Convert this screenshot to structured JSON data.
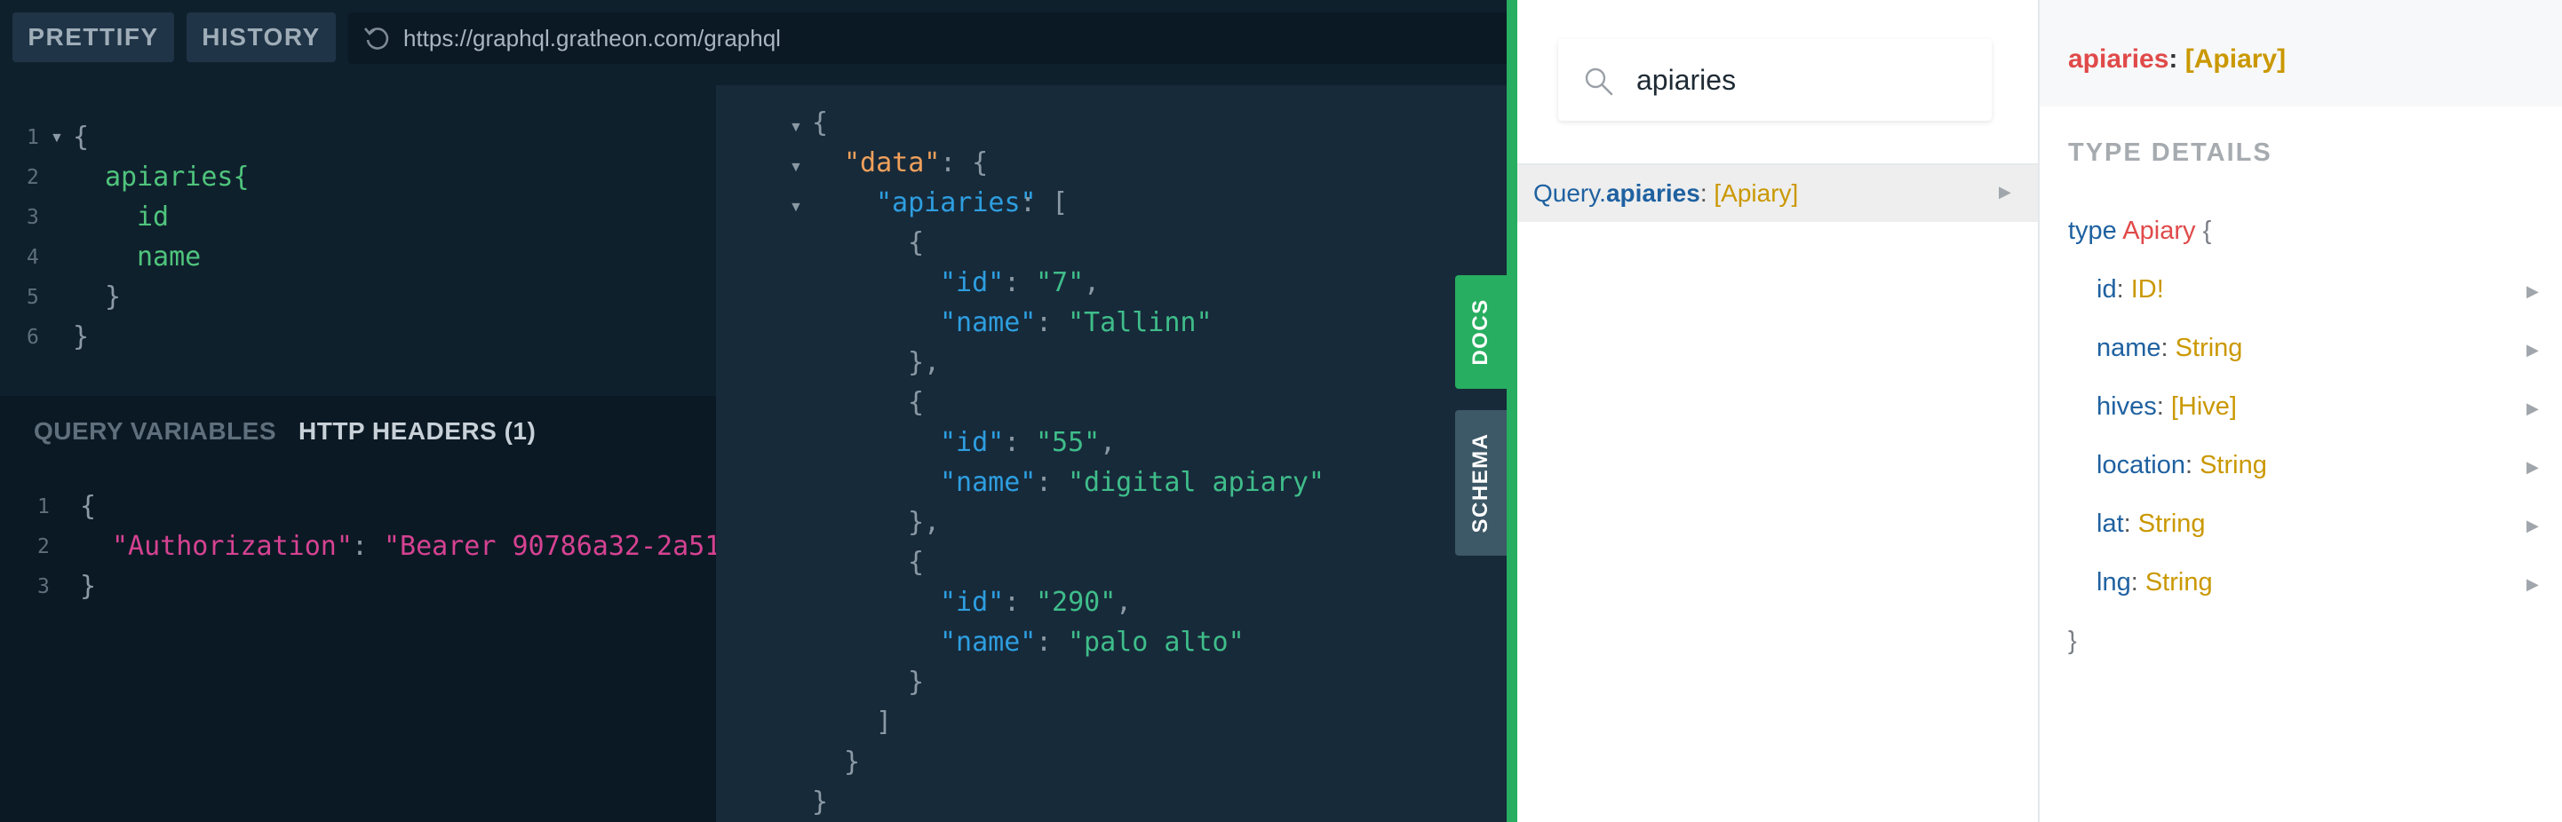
{
  "toolbar": {
    "prettify_label": "PRETTIFY",
    "history_label": "HISTORY",
    "url": "https://graphql.gratheon.com/graphql"
  },
  "editor": {
    "line_numbers": [
      "1",
      "2",
      "3",
      "4",
      "5",
      "6"
    ],
    "lines": [
      "{",
      "apiaries{",
      "id",
      "name",
      "}",
      "}"
    ]
  },
  "variables": {
    "tab_query_variables": "QUERY VARIABLES",
    "tab_http_headers": "HTTP HEADERS (1)",
    "line_numbers": [
      "1",
      "2",
      "3"
    ],
    "open_brace": "{",
    "header_key": "\"Authorization\"",
    "colon": ": ",
    "header_value": "\"Bearer 90786a32-2a51",
    "close_brace": "}"
  },
  "result": {
    "lines": {
      "open": "{",
      "data_key": "\"data\"",
      "data_open": ": {",
      "apiaries_key": "\"apiaries\"",
      "apiaries_open": ": [",
      "obj_open": "{",
      "id_key": "\"id\"",
      "name_key": "\"name\"",
      "obj_close_comma": "},",
      "obj_close": "}",
      "arr_close": "]",
      "data_close": "}",
      "root_close": "}"
    },
    "items": [
      {
        "id": "\"7\"",
        "name": "\"Tallinn\""
      },
      {
        "id": "\"55\"",
        "name": "\"digital apiary\""
      },
      {
        "id": "\"290\"",
        "name": "\"palo alto\""
      }
    ]
  },
  "side_tabs": {
    "docs": "DOCS",
    "schema": "SCHEMA"
  },
  "docs": {
    "search_value": "apiaries",
    "result_row": {
      "prefix": "Query.",
      "name": "apiaries",
      "sep": ": ",
      "type": "[Apiary]"
    },
    "detail": {
      "title_name": "apiaries",
      "title_sep": ": ",
      "title_type": "[Apiary]",
      "section_label": "TYPE DETAILS",
      "type_kw": "type",
      "type_name": "Apiary",
      "open_brace": "{",
      "close_brace": "}",
      "fields": [
        {
          "name": "id",
          "type": "ID!"
        },
        {
          "name": "name",
          "type": "String"
        },
        {
          "name": "hives",
          "type": "[Hive]"
        },
        {
          "name": "location",
          "type": "String"
        },
        {
          "name": "lat",
          "type": "String"
        },
        {
          "name": "lng",
          "type": "String"
        }
      ]
    }
  },
  "colors": {
    "editor_bg": "#0f202d",
    "result_bg": "#172a3a",
    "accent_green": "#27ae60",
    "field_green": "#4fc47c",
    "json_key_blue": "#2e9ee0",
    "json_string_green": "#3fbd8a",
    "data_key_orange": "#f0a05b",
    "header_key_pink": "#d64292",
    "docs_type_orange": "#ca9800",
    "docs_name_red": "#e04a4a",
    "docs_blue": "#1f61a0"
  }
}
